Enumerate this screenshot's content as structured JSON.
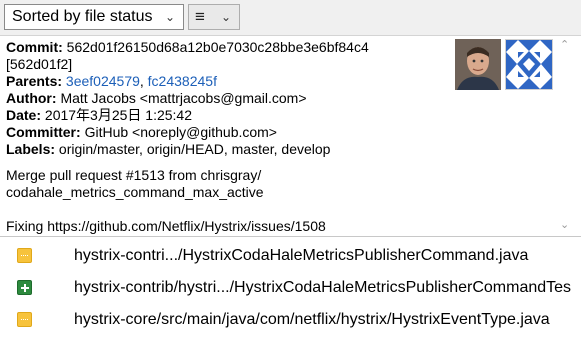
{
  "toolbar": {
    "sort_label": "Sorted by file status",
    "view_icon": "list-view-icon"
  },
  "commit": {
    "commit_label": "Commit:",
    "commit_hash": "562d01f26150d68a12b0e7030c28bbe3e6bf84c4",
    "commit_short": "[562d01f2]",
    "parents_label": "Parents:",
    "parent1": "3eef024579",
    "parent_sep": ",",
    "parent2": "fc2438245f",
    "author_label": "Author:",
    "author_value": "Matt Jacobs <mattrjacobs@gmail.com>",
    "date_label": "Date:",
    "date_value": "2017年3月25日 1:25:42",
    "committer_label": "Committer:",
    "committer_value": "GitHub <noreply@github.com>",
    "labels_label": "Labels:",
    "labels_value": "origin/master, origin/HEAD, master, develop",
    "message_line1": "Merge pull request #1513 from chrisgray/",
    "message_line2": "codahale_metrics_command_max_active",
    "message_line3": "Fixing https://github.com/Netflix/Hystrix/issues/1508",
    "link_color": "#1c5fb8"
  },
  "files": [
    {
      "status": "modified",
      "path": "hystrix-contri.../HystrixCodaHaleMetricsPublisherCommand.java"
    },
    {
      "status": "added",
      "path": "hystrix-contrib/hystri.../HystrixCodaHaleMetricsPublisherCommandTes"
    },
    {
      "status": "modified",
      "path": "hystrix-core/src/main/java/com/netflix/hystrix/HystrixEventType.java"
    }
  ],
  "colors": {
    "modified": "#f7c33c",
    "added": "#2d8a3e"
  }
}
